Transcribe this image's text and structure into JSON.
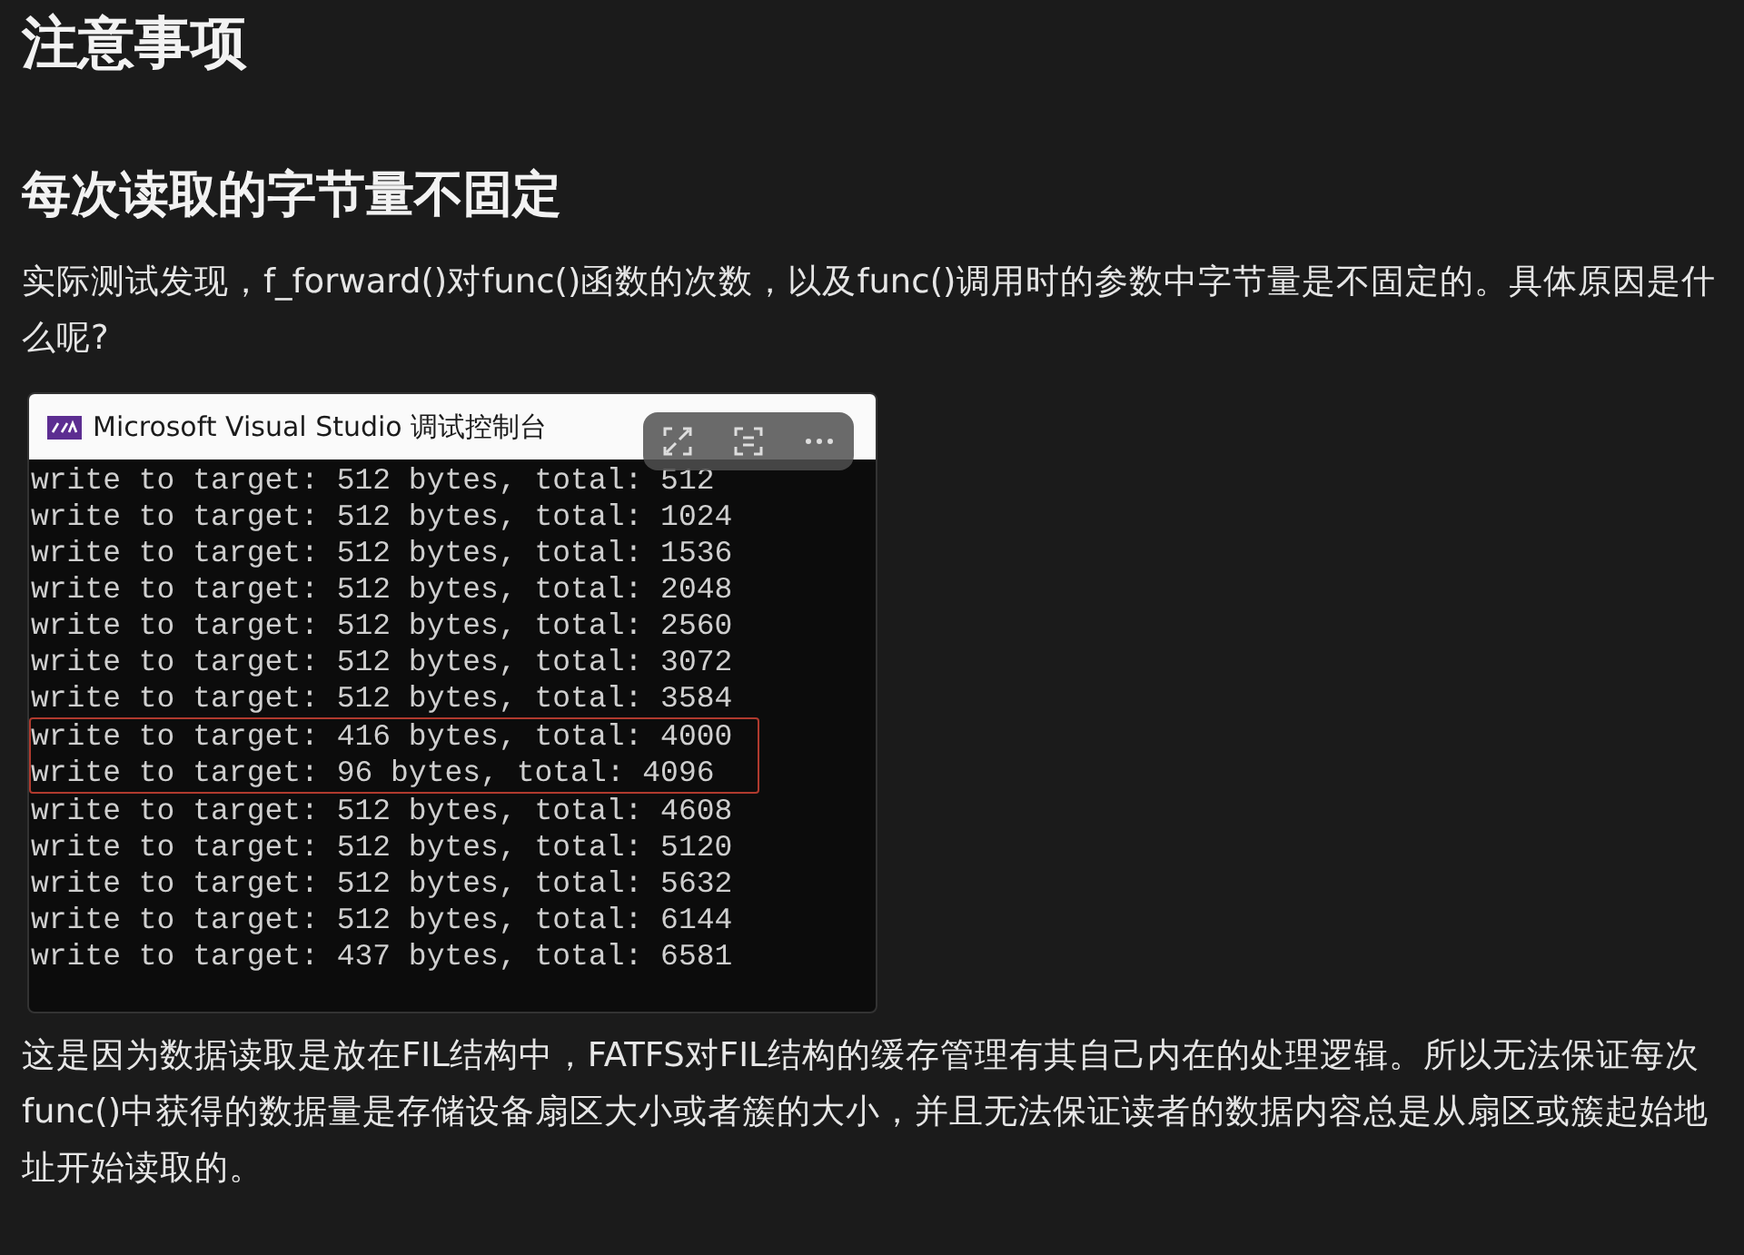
{
  "heading": "注意事项",
  "subheading": "每次读取的字节量不固定",
  "intro": "实际测试发现，f_forward()对func()函数的次数，以及func()调用时的参数中字节量是不固定的。具体原因是什么呢?",
  "console": {
    "title": "Microsoft Visual Studio 调试控制台",
    "lines": [
      {
        "text": "write to target: 512 bytes, total: 512",
        "highlighted": false
      },
      {
        "text": "write to target: 512 bytes, total: 1024",
        "highlighted": false
      },
      {
        "text": "write to target: 512 bytes, total: 1536",
        "highlighted": false
      },
      {
        "text": "write to target: 512 bytes, total: 2048",
        "highlighted": false
      },
      {
        "text": "write to target: 512 bytes, total: 2560",
        "highlighted": false
      },
      {
        "text": "write to target: 512 bytes, total: 3072",
        "highlighted": false
      },
      {
        "text": "write to target: 512 bytes, total: 3584",
        "highlighted": false
      },
      {
        "text": "write to target: 416 bytes, total: 4000",
        "highlighted": true
      },
      {
        "text": "write to target: 96 bytes, total: 4096",
        "highlighted": true
      },
      {
        "text": "write to target: 512 bytes, total: 4608",
        "highlighted": false
      },
      {
        "text": "write to target: 512 bytes, total: 5120",
        "highlighted": false
      },
      {
        "text": "write to target: 512 bytes, total: 5632",
        "highlighted": false
      },
      {
        "text": "write to target: 512 bytes, total: 6144",
        "highlighted": false
      },
      {
        "text": "write to target: 437 bytes, total: 6581",
        "highlighted": false
      }
    ]
  },
  "explanation": "这是因为数据读取是放在FIL结构中，FATFS对FIL结构的缓存管理有其自己内在的处理逻辑。所以无法保证每次func()中获得的数据量是存储设备扇区大小或者簇的大小，并且无法保证读者的数据内容总是从扇区或簇起始地址开始读取的。"
}
